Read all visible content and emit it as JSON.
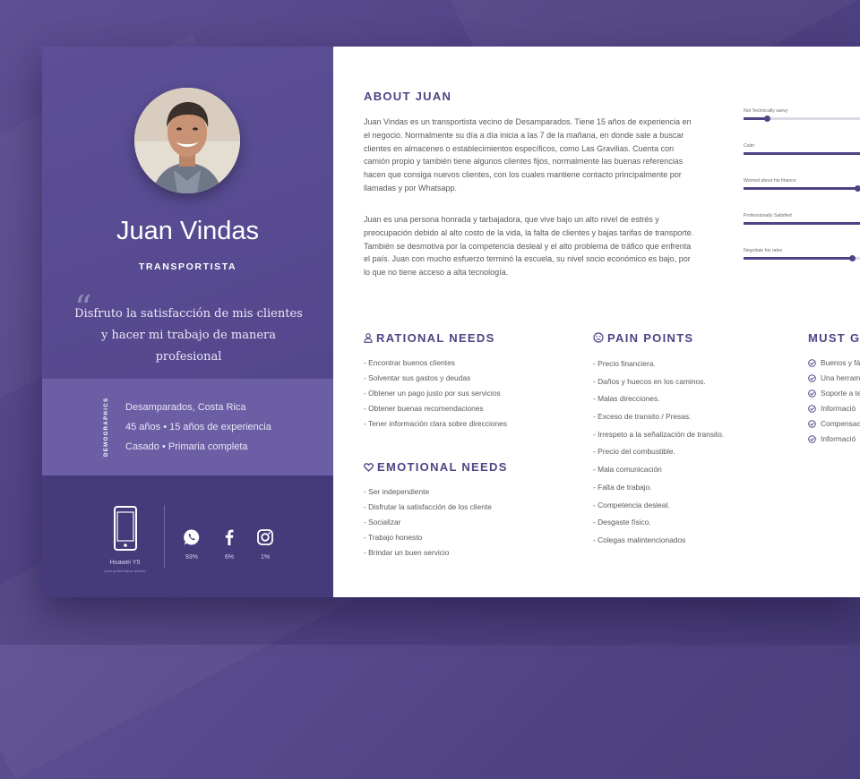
{
  "persona": {
    "name": "Juan Vindas",
    "role": "TRANSPORTISTA",
    "quote": "Disfruto la satisfacción de mis clientes y hacer mi trabajo de manera profesional",
    "quote_mark": "“",
    "photo_icon": "portrait-photo"
  },
  "demographics": {
    "title": "DEMOGRAPHICS",
    "lines": [
      "Desamparados, Costa Rica",
      "45 años • 15 años de experiencia",
      "Casado • Primaria completa"
    ]
  },
  "device": {
    "name": "Huawei Y5",
    "subtitle": "(Low performance device)",
    "icon": "smartphone-icon",
    "apps": [
      {
        "name": "whatsapp",
        "icon": "whatsapp-icon",
        "pct": "93%"
      },
      {
        "name": "facebook",
        "icon": "facebook-icon",
        "pct": "6%"
      },
      {
        "name": "instagram",
        "icon": "instagram-icon",
        "pct": "1%"
      }
    ]
  },
  "about": {
    "title": "ABOUT JUAN",
    "paragraphs": [
      "Juan Vindas es un transportista vecino de Desamparados. Tiene 15 años de experiencia en el negocio. Normalmente su día a día inicia a las 7 de la mañana, en donde sale a buscar clientes en almacenes o establecimientos específicos, como Las Gravilias. Cuenta con camión propio y también tiene algunos clientes fijos, normalmente las buenas referencias hacen que consiga nuevos clientes, con los cuales mantiene contacto principalmente por llamadas y por Whatsapp.",
      "Juan es una persona honrada y tarbajadora, que vive bajo un alto nivel de estrés y preocupación debido al alto costo de la vida, la falta de clientes y bajas tarifas de transporte. También se desmotiva por la competencia desleal y el alto problema de tráfico que enfrenta el país. Juan con mucho esfuerzo terminó la escuela, su nivel socio económico es bajo, por lo que no tiene acceso a alta tecnología."
    ]
  },
  "traits": [
    {
      "label": "Not Technically savvy",
      "value": 0.2
    },
    {
      "label": "Calm",
      "value": 1.0
    },
    {
      "label": "Worried about his finance",
      "value": 0.98
    },
    {
      "label": "Professionally Satisfied",
      "value": 1.0
    },
    {
      "label": "Negotiate his rates",
      "value": 0.93
    }
  ],
  "rational_needs": {
    "title": "RATIONAL NEEDS",
    "icon": "user-icon",
    "items": [
      "- Encontrar buenos clientes",
      "- Solventar sus gastos y deudas",
      "- Obtener un pago justo por sus servicios",
      "- Obtener buenas recomendaciones",
      "- Tener información clara sobre direcciones"
    ]
  },
  "emotional_needs": {
    "title": "EMOTIONAL NEEDS",
    "icon": "heart-icon",
    "items": [
      "- Ser independiente",
      "- Disfrutar la satisfacción de los cliente",
      "- Socializar",
      "- Trabajo honesto",
      "- Brindar un buen servicio"
    ]
  },
  "pain_points": {
    "title": "PAIN POINTS",
    "icon": "sad-face-icon",
    "items": [
      "- Precio financiera.",
      "- Daños y huecos en los caminos.",
      "- Malas direcciones.",
      "- Exceso de transito / Presas.",
      "- Irrespeto a la señalización de transito.",
      "- Precio del combustible.",
      "- Mala comunicación",
      "- Falta de trabajo.",
      "- Competencia desleal.",
      "- Desgaste físico.",
      "- Colegas malintencionados"
    ]
  },
  "must_get": {
    "title": "MUST GE",
    "items": [
      "Buenos y fá",
      "Una herram",
      "Soporte a te",
      "Informació",
      "Compensac",
      "Informació"
    ]
  },
  "colors": {
    "accent": "#4d4485",
    "left_panel": "#5b4d95",
    "demographics": "#6b5ea4",
    "devices": "#453a7a"
  }
}
